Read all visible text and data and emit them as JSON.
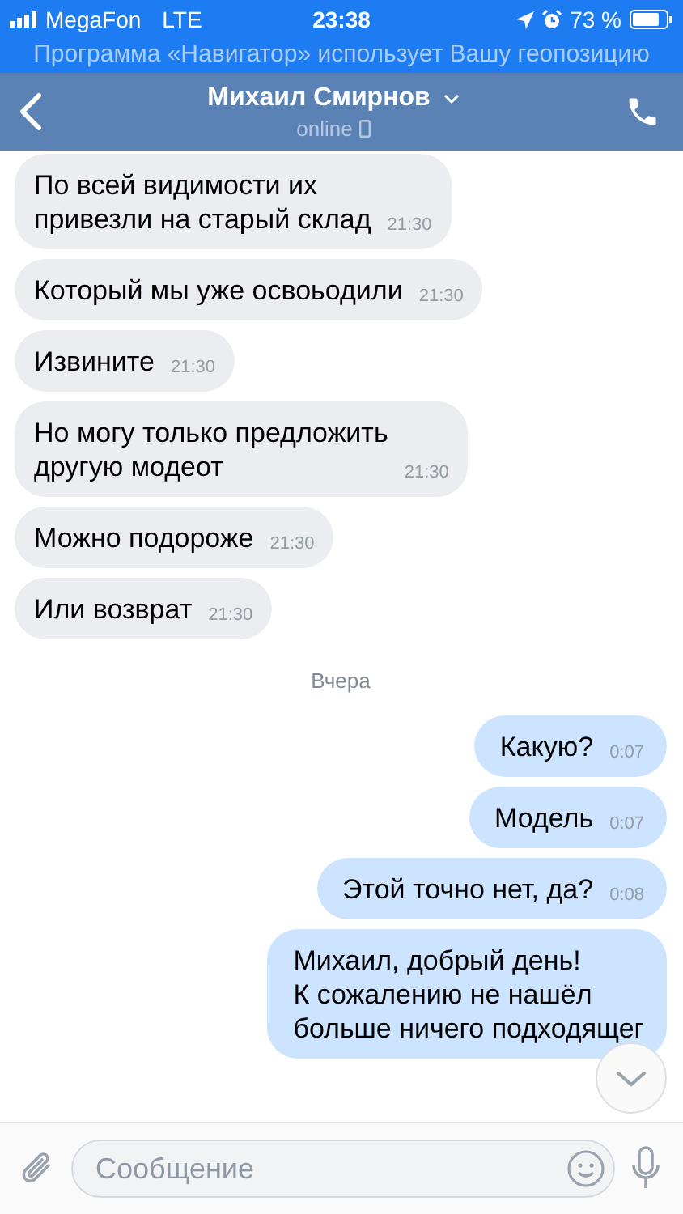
{
  "status_bar": {
    "carrier": "MegaFon",
    "network": "LTE",
    "time": "23:38",
    "battery": "73 %"
  },
  "location_banner": "Программа «Навигатор» использует Вашу геопозицию",
  "header": {
    "name": "Михаил Смирнов",
    "status": "online"
  },
  "messages": [
    {
      "kind": "incoming",
      "text": "По всей видимости их\nпривезли на старый склад",
      "time": "21:30"
    },
    {
      "kind": "incoming",
      "text": "Который мы уже освоьодили",
      "time": "21:30"
    },
    {
      "kind": "incoming",
      "text": "Извините",
      "time": "21:30"
    },
    {
      "kind": "incoming",
      "text": "Но могу только предложить\nдругую модеот",
      "time": "21:30"
    },
    {
      "kind": "incoming",
      "text": "Можно подороже",
      "time": "21:30"
    },
    {
      "kind": "incoming",
      "text": "Или возврат",
      "time": "21:30"
    },
    {
      "kind": "date",
      "text": "Вчера"
    },
    {
      "kind": "outgoing",
      "text": "Какую?",
      "time": "0:07"
    },
    {
      "kind": "outgoing",
      "text": "Модель",
      "time": "0:07"
    },
    {
      "kind": "outgoing",
      "text": "Этой точно нет, да?",
      "time": "0:08"
    },
    {
      "kind": "outgoing",
      "text": "Михаил, добрый день!\nК сожалению не нашёл\nбольше ничего подходящег"
    }
  ],
  "composer": {
    "placeholder": "Сообщение"
  }
}
